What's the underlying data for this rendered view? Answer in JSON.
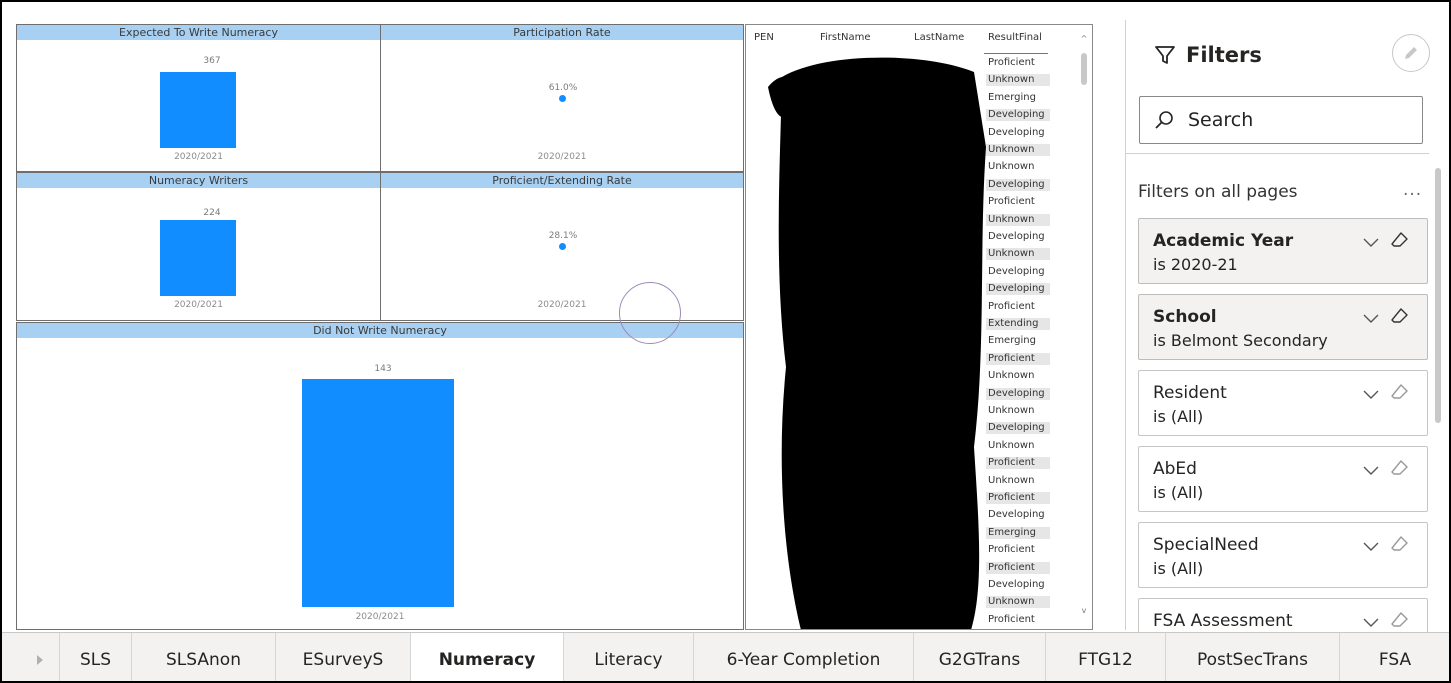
{
  "visuals": {
    "expected": {
      "title": "Expected To Write Numeracy",
      "value_label": "367",
      "x_label": "2020/2021"
    },
    "participation": {
      "title": "Participation Rate",
      "value_label": "61.0%",
      "x_label": "2020/2021"
    },
    "writers": {
      "title": "Numeracy Writers",
      "value_label": "224",
      "x_label": "2020/2021"
    },
    "proficient": {
      "title": "Proficient/Extending Rate",
      "value_label": "28.1%",
      "x_label": "2020/2021"
    },
    "notwrite": {
      "title": "Did Not Write Numeracy",
      "value_label": "143",
      "x_label": "2020/2021"
    }
  },
  "chart_data": [
    {
      "type": "bar",
      "title": "Expected To Write Numeracy",
      "categories": [
        "2020/2021"
      ],
      "values": [
        367
      ]
    },
    {
      "type": "scatter",
      "title": "Participation Rate",
      "categories": [
        "2020/2021"
      ],
      "values": [
        61.0
      ]
    },
    {
      "type": "bar",
      "title": "Numeracy Writers",
      "categories": [
        "2020/2021"
      ],
      "values": [
        224
      ]
    },
    {
      "type": "scatter",
      "title": "Proficient/Extending Rate",
      "categories": [
        "2020/2021"
      ],
      "values": [
        28.1
      ]
    },
    {
      "type": "bar",
      "title": "Did Not Write Numeracy",
      "categories": [
        "2020/2021"
      ],
      "values": [
        143
      ]
    }
  ],
  "table": {
    "columns": [
      "PEN",
      "FirstName",
      "LastName",
      "ResultFinal"
    ],
    "results": [
      "Proficient",
      "Unknown",
      "Emerging",
      "Developing",
      "Developing",
      "Unknown",
      "Unknown",
      "Developing",
      "Proficient",
      "Unknown",
      "Developing",
      "Unknown",
      "Developing",
      "Developing",
      "Proficient",
      "Extending",
      "Emerging",
      "Proficient",
      "Unknown",
      "Developing",
      "Unknown",
      "Developing",
      "Unknown",
      "Proficient",
      "Unknown",
      "Proficient",
      "Developing",
      "Emerging",
      "Proficient",
      "Proficient",
      "Developing",
      "Unknown",
      "Proficient"
    ]
  },
  "filters": {
    "title": "Filters",
    "search_placeholder": "Search",
    "section": "Filters on all pages",
    "more": "...",
    "cards": [
      {
        "name": "Academic Year",
        "value": "is 2020-21",
        "active": true
      },
      {
        "name": "School",
        "value": "is Belmont Secondary",
        "active": true
      },
      {
        "name": "Resident",
        "value": "is (All)",
        "active": false
      },
      {
        "name": "AbEd",
        "value": "is (All)",
        "active": false
      },
      {
        "name": "SpecialNeed",
        "value": "is (All)",
        "active": false
      },
      {
        "name": "FSA Assessment",
        "value": "",
        "active": false
      }
    ]
  },
  "tabs": [
    "SLS",
    "SLSAnon",
    "ESurveyS",
    "Numeracy",
    "Literacy",
    "6-Year Completion",
    "G2GTrans",
    "FTG12",
    "PostSecTrans",
    "FSA"
  ],
  "active_tab": "Numeracy",
  "colors": {
    "bar": "#118dff",
    "title_band": "#a7d0f2",
    "active_tab_underline": "#f2c811"
  }
}
